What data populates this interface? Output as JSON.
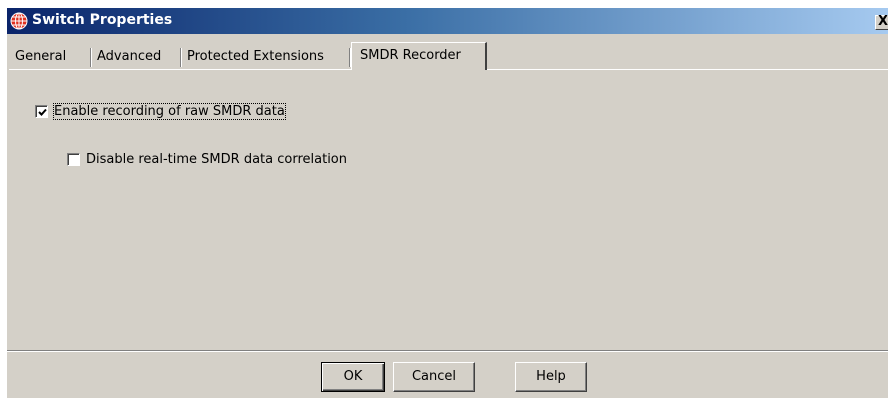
{
  "window": {
    "title": "Switch Properties",
    "close_label": "X"
  },
  "tabs": [
    {
      "label": "General",
      "active": false
    },
    {
      "label": "Advanced",
      "active": false
    },
    {
      "label": "Protected Extensions",
      "active": false
    },
    {
      "label": "SMDR Recorder",
      "active": true
    }
  ],
  "options": {
    "enable_recording": {
      "label": "Enable recording of raw SMDR data",
      "checked": true
    },
    "disable_correlation": {
      "label": "Disable real-time SMDR data correlation",
      "checked": false
    }
  },
  "buttons": {
    "ok": "OK",
    "cancel": "Cancel",
    "help": "Help"
  },
  "colors": {
    "title_gradient_start": "#0a246a",
    "title_gradient_end": "#a6caf0",
    "face": "#d4d0c8"
  }
}
